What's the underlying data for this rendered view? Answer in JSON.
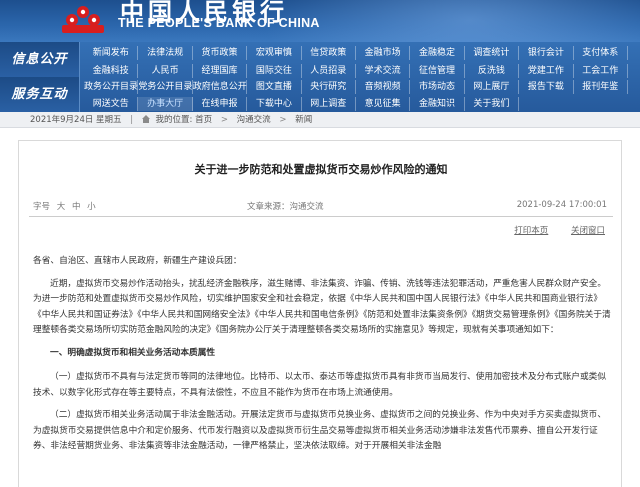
{
  "header": {
    "bank_name_cn": "中国人民银行",
    "bank_name_en": "THE PEOPLE'S BANK OF CHINA",
    "logo_color": "#d81e1e"
  },
  "nav": {
    "section1_label": "信息公开",
    "section2_label": "服务互动",
    "rows": [
      [
        "新闻发布",
        "法律法规",
        "货币政策",
        "宏观审慎",
        "信贷政策",
        "金融市场",
        "金融稳定",
        "调查统计",
        "银行会计",
        "支付体系"
      ],
      [
        "金融科技",
        "人民币",
        "经理国库",
        "国际交往",
        "人员招录",
        "学术交流",
        "征信管理",
        "反洗钱",
        "党建工作",
        "工会工作"
      ],
      [
        "政务公开目录",
        "党务公开目录",
        "政府信息公开",
        "图文直播",
        "央行研究",
        "音频视频",
        "市场动态",
        "网上展厅",
        "报告下载",
        "报刊年鉴"
      ],
      [
        "网送文告",
        "办事大厅",
        "在线申报",
        "下载中心",
        "网上调查",
        "意见征集",
        "金融知识",
        "关于我们",
        "",
        ""
      ]
    ],
    "active_item": "办事大厅"
  },
  "breadcrumb": {
    "date": "2021年9月24日 星期五",
    "prefix": "我的位置:",
    "items": [
      "首页",
      "沟通交流",
      "新闻"
    ]
  },
  "article": {
    "title": "关于进一步防范和处置虚拟货币交易炒作风险的通知",
    "font_label": "字号",
    "font_sizes": [
      "大",
      "中",
      "小"
    ],
    "source": "文章来源：沟通交流",
    "datetime": "2021-09-24 17:00:01",
    "print_label": "打印本页",
    "close_label": "关闭窗口",
    "salutation": "各省、自治区、直辖市人民政府，新疆生产建设兵团：",
    "para1": "近期，虚拟货币交易炒作活动抬头，扰乱经济金融秩序，滋生赌博、非法集资、诈骗、传销、洗钱等违法犯罪活动，严重危害人民群众财产安全。为进一步防范和处置虚拟货币交易炒作风险，切实维护国家安全和社会稳定，依据《中华人民共和国中国人民银行法》《中华人民共和国商业银行法》《中华人民共和国证券法》《中华人民共和国网络安全法》《中华人民共和国电信条例》《防范和处置非法集资条例》《期货交易管理条例》《国务院关于清理整顿各类交易场所切实防范金融风险的决定》《国务院办公厅关于清理整顿各类交易场所的实施意见》等规定，现就有关事项通知如下：",
    "heading1": "一、明确虚拟货币和相关业务活动本质属性",
    "para2": "（一）虚拟货币不具有与法定货币等同的法律地位。比特币、以太币、泰达币等虚拟货币具有非货币当局发行、使用加密技术及分布式账户或类似技术、以数字化形式存在等主要特点，不具有法偿性，不应且不能作为货币在市场上流通使用。",
    "para3": "（二）虚拟货币相关业务活动属于非法金融活动。开展法定货币与虚拟货币兑换业务、虚拟货币之间的兑换业务、作为中央对手方买卖虚拟货币、为虚拟货币交易提供信息中介和定价服务、代币发行融资以及虚拟货币衍生品交易等虚拟货币相关业务活动涉嫌非法发售代币票券、擅自公开发行证券、非法经营期货业务、非法集资等非法金融活动，一律严格禁止，坚决依法取缔。对于开展相关非法金融"
  }
}
